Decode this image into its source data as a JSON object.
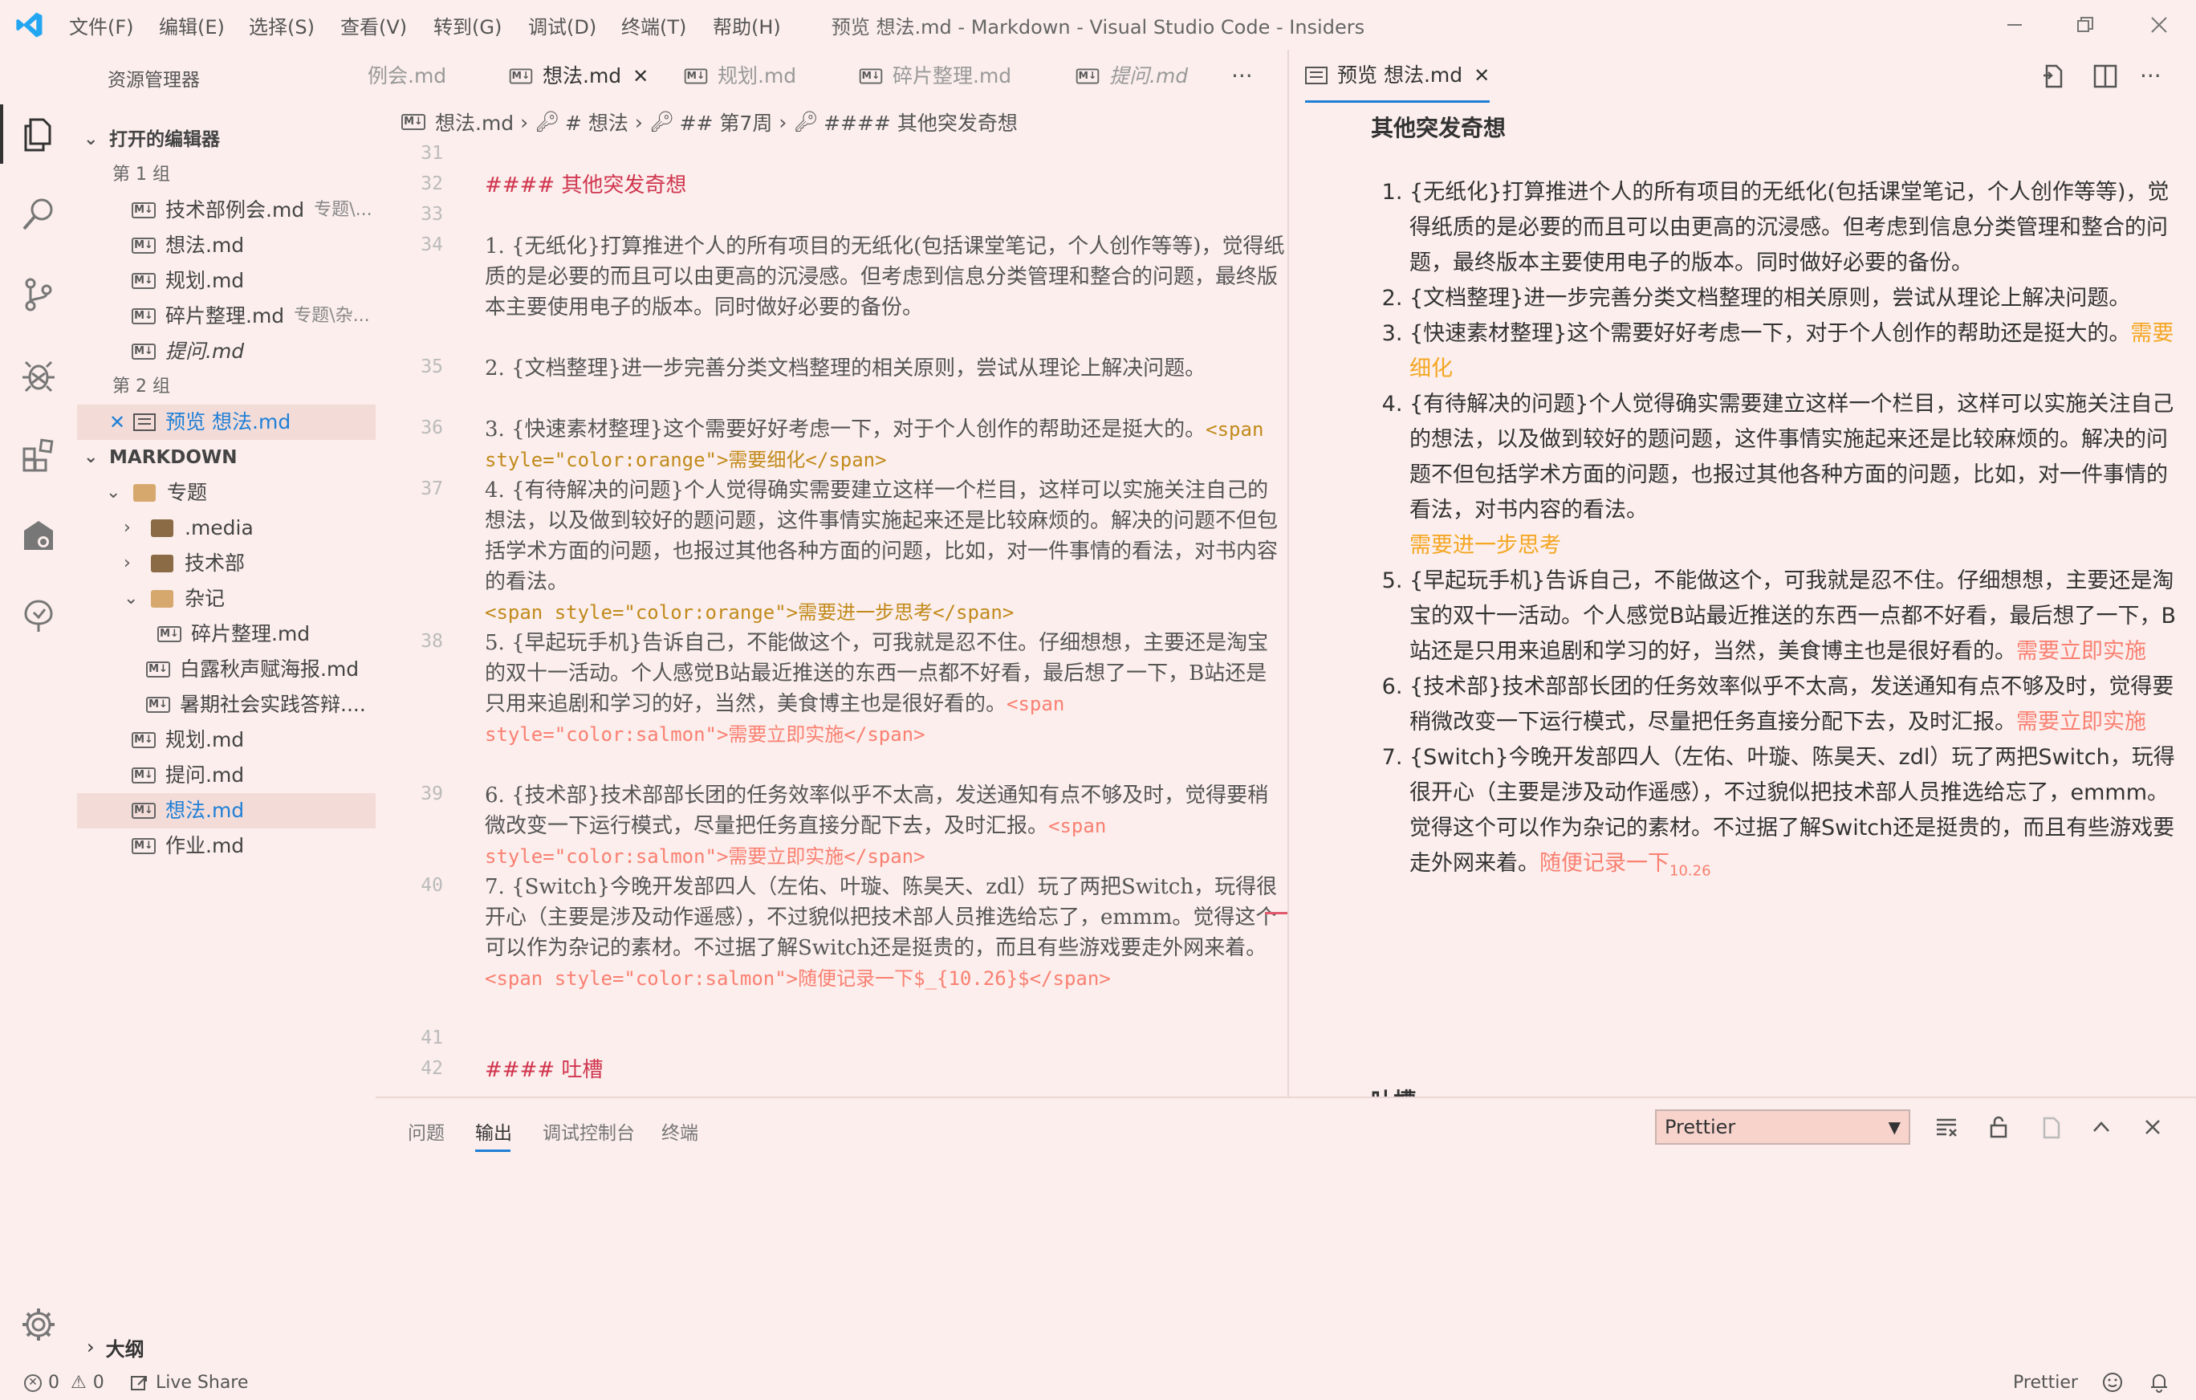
{
  "window": {
    "menu": [
      "文件(F)",
      "编辑(E)",
      "选择(S)",
      "查看(V)",
      "转到(G)",
      "调试(D)",
      "终端(T)",
      "帮助(H)"
    ],
    "title": "预览 想法.md - Markdown - Visual Studio Code - Insiders"
  },
  "sidebar": {
    "title": "资源管理器",
    "open_editors": "打开的编辑器",
    "group1": "第 1 组",
    "group1_files": [
      {
        "name": "技术部例会.md",
        "desc": "专题\\..."
      },
      {
        "name": "想法.md",
        "desc": ""
      },
      {
        "name": "规划.md",
        "desc": ""
      },
      {
        "name": "碎片整理.md",
        "desc": "专题\\杂..."
      },
      {
        "name": "提问.md",
        "desc": ""
      }
    ],
    "group2": "第 2 组",
    "group2_file": "预览 想法.md",
    "workspace": "MARKDOWN",
    "tree": {
      "zhuanti": "专题",
      "media": ".media",
      "jishubu": "技术部",
      "zaji": "杂记",
      "suipian": "碎片整理.md",
      "bailu": "白露秋声赋海报.md",
      "shuqi": "暑期社会实践答辩....",
      "guihua": "规划.md",
      "tiwen": "提问.md",
      "xiangfa": "想法.md",
      "zuoye": "作业.md"
    },
    "outline": "大纲"
  },
  "editor": {
    "tabs": [
      "例会.md",
      "想法.md",
      "规划.md",
      "碎片整理.md",
      "提问.md"
    ],
    "more": "···",
    "breadcrumb": [
      "想法.md",
      "# 想法",
      "## 第7周",
      "#### 其他突发奇想"
    ],
    "line_numbers": [
      "31",
      "32",
      "33",
      "34",
      "35",
      "36",
      "37",
      "38",
      "39",
      "40",
      "41",
      "42"
    ],
    "lines": {
      "l32": "#### 其他突发奇想",
      "l34": "1. {无纸化}打算推进个人的所有项目的无纸化(包括课堂笔记，个人创作等等)，觉得纸质的是必要的而且可以由更高的沉浸感。但考虑到信息分类管理和整合的问题，最终版本主要使用电子的版本。同时做好必要的备份。",
      "l35": "2. {文档整理}进一步完善分类文档整理的相关原则，尝试从理论上解决问题。",
      "l36a": "3. {快速素材整理}这个需要好好考虑一下，对于个人创作的帮助还是挺大的。",
      "l36b": "<span style=\"color:orange\">需要细化</span>",
      "l37a": "4. {有待解决的问题}个人觉得确实需要建立这样一个栏目，这样可以实施关注自己的想法，以及做到较好的题问题，这件事情实施起来还是比较麻烦的。解决的问题不但包括学术方面的问题，也报过其他各种方面的问题，比如，对一件事情的看法，对书内容的看法。",
      "l37b": "<span style=\"color:orange\">需要进一步思考</span>",
      "l38a": "5. {早起玩手机}告诉自己，不能做这个，可我就是忍不住。仔细想想，主要还是淘宝的双十一活动。个人感觉B站最近推送的东西一点都不好看，最后想了一下，B站还是只用来追剧和学习的好，当然，美食博主也是很好看的。",
      "l38b": "<span style=\"color:salmon\">需要立即实施</span>",
      "l39a": "6. {技术部}技术部部长团的任务效率似乎不太高，发送通知有点不够及时，觉得要稍微改变一下运行模式，尽量把任务直接分配下去，及时汇报。",
      "l39b": "<span style=\"color:salmon\">需要立即实施</span>",
      "l40a": "7. {Switch}今晚开发部四人（左佑、叶璇、陈昊天、zdl）玩了两把Switch，玩得很开心（主要是涉及动作遥感），不过貌似把技术部人员推选给忘了，emmm。觉得这个可以作为杂记的素材。不过据了解Switch还是挺贵的，而且有些游戏要走外网来着。",
      "l40b": "<span style=\"color:salmon\">随便记录一下$_{10.26}$</span>",
      "l42": "#### 吐槽"
    }
  },
  "preview": {
    "tab": "预览 想法.md",
    "heading": "其他突发奇想",
    "items": [
      {
        "text": "{无纸化}打算推进个人的所有项目的无纸化(包括课堂笔记，个人创作等等)，觉得纸质的是必要的而且可以由更高的沉浸感。但考虑到信息分类管理和整合的问题，最终版本主要使用电子的版本。同时做好必要的备份。",
        "note": "",
        "note_color": ""
      },
      {
        "text": "{文档整理}进一步完善分类文档整理的相关原则，尝试从理论上解决问题。",
        "note": "",
        "note_color": ""
      },
      {
        "text": "{快速素材整理}这个需要好好考虑一下，对于个人创作的帮助还是挺大的。",
        "note": "需要细化",
        "note_color": "#f5a623"
      },
      {
        "text": "{有待解决的问题}个人觉得确实需要建立这样一个栏目，这样可以实施关注自己的想法，以及做到较好的题问题，这件事情实施起来还是比较麻烦的。解决的问题不但包括学术方面的问题，也报过其他各种方面的问题，比如，对一件事情的看法，对书内容的看法。",
        "note": "需要进一步思考",
        "note_color": "#f5a623"
      },
      {
        "text": "{早起玩手机}告诉自己，不能做这个，可我就是忍不住。仔细想想，主要还是淘宝的双十一活动。个人感觉B站最近推送的东西一点都不好看，最后想了一下，B站还是只用来追剧和学习的好，当然，美食博主也是很好看的。",
        "note": "需要立即实施",
        "note_color": "#fa8072"
      },
      {
        "text": "{技术部}技术部部长团的任务效率似乎不太高，发送通知有点不够及时，觉得要稍微改变一下运行模式，尽量把任务直接分配下去，及时汇报。",
        "note": "需要立即实施",
        "note_color": "#fa8072"
      },
      {
        "text": "{Switch}今晚开发部四人（左佑、叶璇、陈昊天、zdl）玩了两把Switch，玩得很开心（主要是涉及动作遥感），不过貌似把技术部人员推选给忘了，emmm。觉得这个可以作为杂记的素材。不过据了解Switch还是挺贵的，而且有些游戏要走外网来着。",
        "note": "随便记录一下",
        "note_color": "#fa8072",
        "sub": "10.26"
      }
    ],
    "next_heading": "吐槽"
  },
  "panel": {
    "tabs": [
      "问题",
      "输出",
      "调试控制台",
      "终端"
    ],
    "active_tab": "输出",
    "select_value": "Prettier"
  },
  "status": {
    "errors": "0",
    "warnings": "0",
    "live_share": "Live Share",
    "prettier": "Prettier"
  },
  "colors": {
    "background": "#fbeeec",
    "accent": "#1f7fd6",
    "heading_red": "#d0364f",
    "orange": "#f5a623",
    "salmon": "#fa8072"
  }
}
